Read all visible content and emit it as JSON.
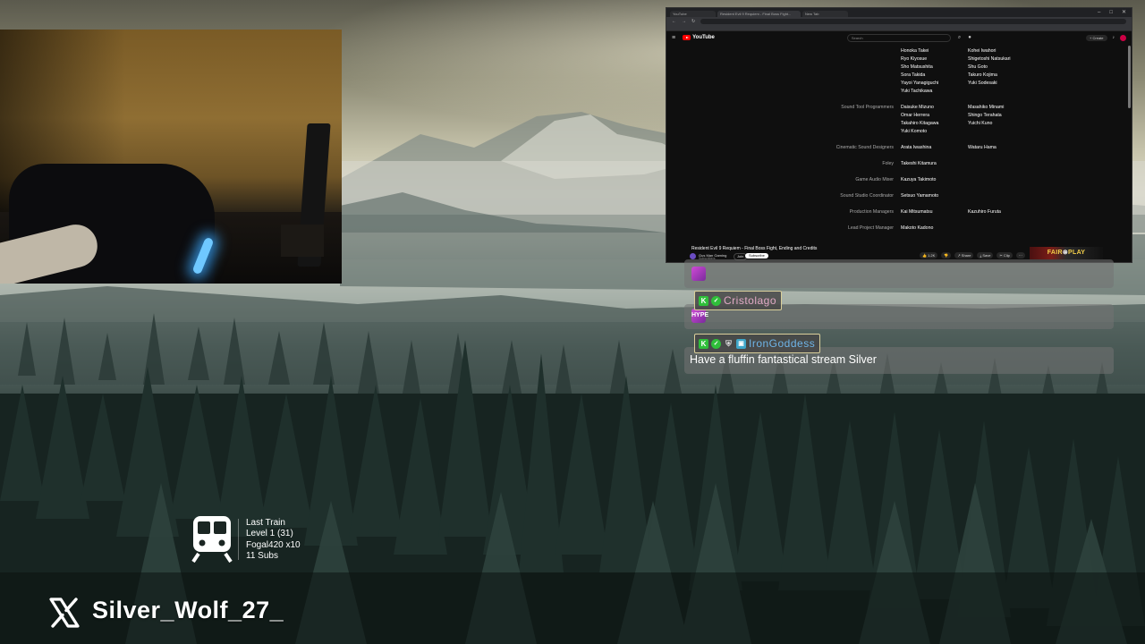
{
  "browser": {
    "tabs": [
      "YouTube",
      "Resident Evil 9 Requiem - Final Boss Fight...",
      "New Tab"
    ],
    "youtube": {
      "logo": "YouTube",
      "search_placeholder": "Search",
      "create": "+ Create"
    },
    "credits": [
      {
        "role": "",
        "col1": "Honoka Takei",
        "col2": "Kohei Iwahori"
      },
      {
        "role": "",
        "col1": "Ryo Kiyosue",
        "col2": "Shigetoshi Natsukari"
      },
      {
        "role": "",
        "col1": "Sho Matsushita",
        "col2": "Shu Goto"
      },
      {
        "role": "",
        "col1": "Sora Takida",
        "col2": "Takuro Kojima"
      },
      {
        "role": "",
        "col1": "Yayoi Yanagiguchi",
        "col2": "Yuki Sodesaki"
      },
      {
        "role": "",
        "col1": "Yuki Tachikawa",
        "col2": ""
      },
      {
        "role": "Sound Tool Programmers",
        "col1": "Daisuke Mizuno",
        "col2": "Masahiko Minami"
      },
      {
        "role": "",
        "col1": "Omar Herrera",
        "col2": "Shingo Terahata"
      },
      {
        "role": "",
        "col1": "Takahiro Kitagawa",
        "col2": "Yuichi Kuno"
      },
      {
        "role": "",
        "col1": "Yuki Komoto",
        "col2": ""
      },
      {
        "role": "Cinematic Sound Designers",
        "col1": "Arata Iwashina",
        "col2": "Wataru Hama"
      },
      {
        "role": "Foley",
        "col1": "Takeshi Kitamura",
        "col2": ""
      },
      {
        "role": "Game Audio Mixer",
        "col1": "Kazuya Takimoto",
        "col2": ""
      },
      {
        "role": "Sound Studio Coordinator",
        "col1": "Setsuo Yamamoto",
        "col2": ""
      },
      {
        "role": "Production Managers",
        "col1": "Kai Mitsumatsu",
        "col2": "Kazuhiro Furuta"
      },
      {
        "role": "Lead Project Manager",
        "col1": "Makoto Kadono",
        "col2": ""
      }
    ],
    "video": {
      "title": "Resident Evil 9 Requiem - Final Boss Fight, Ending and Credits",
      "channel": "Gus Man Gaming",
      "subscribers": "Subscribers",
      "join": "Join",
      "subscribe": "Subscribe",
      "actions": [
        "👍 1.2K",
        "👎",
        "↗ Share",
        "⤓ Save",
        "✂ Clip",
        "⋯"
      ],
      "ad_text_a": "FAIR",
      "ad_text_b": "PLAY"
    }
  },
  "chat": {
    "messages": [
      {
        "user": "",
        "text": "",
        "emote": ""
      },
      {
        "user": "Cristolago",
        "text": "",
        "emote": "HYPE"
      },
      {
        "user": "IronGoddess",
        "text": "Have a fluffin fantastical stream Silver",
        "emote": ""
      }
    ]
  },
  "train": {
    "title": "Last Train",
    "level": "Level 1  (31)",
    "top": "Fogal420 x10",
    "subs": "11 Subs"
  },
  "social": {
    "handle": "Silver_Wolf_27_"
  },
  "colors": {
    "chat_tag_border": "#d9cf9a",
    "kick_green": "#2fbf3a",
    "youtube_red": "#ff0000"
  },
  "icons": [
    "train-icon",
    "x-logo-icon",
    "kick-badge-icon",
    "verified-badge-icon",
    "moderator-shield-icon",
    "bot-badge-icon"
  ]
}
